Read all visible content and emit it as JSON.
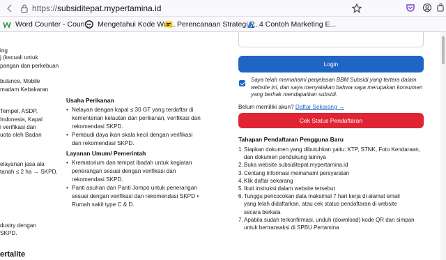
{
  "browser": {
    "url_prefix": "https://",
    "url_domain": "subsiditepat.mypertamina.id",
    "icons": [
      "lock-icon",
      "star-icon",
      "pocket-icon",
      "account-icon",
      "extensions-icon"
    ]
  },
  "bookmarks": [
    {
      "label": "Word Counter - Count...",
      "icon": "wordcounter-icon"
    },
    {
      "label": "Mengetahui Kode War...",
      "icon": "edge-icon"
    },
    {
      "label": "Perencanaan Strategi P...",
      "icon": "miro-icon"
    },
    {
      "label": "4 Contoh Marketing E...",
      "icon": "azure-icon"
    }
  ],
  "left_col": {
    "lines": [
      "ing",
      "j (kecuali untuk",
      "pangan dan perkebuan",
      "bulance, Mobile",
      "madam Kebakaran",
      "Tempel, ASDP,",
      "Indonesia, Kapal",
      "i verifikasi dan",
      "uota oleh Badan",
      "elayanan jasa ala",
      "tanah ≤ 2 ha → SKPD.",
      "dustry dengan",
      "SKPD."
    ]
  },
  "usaha_perikanan": {
    "heading": "Usaha Perikanan",
    "bullets": [
      "Nelayan dengan kapal ≤ 30 GT yang terdaftar di\nkementerian kelautan dan perikanan, verifikasi dan\nrekomendasi SKPD.",
      "Pembudi daya ikan skala kecil dengan verifikasi\ndan rekomendasi SKPD."
    ]
  },
  "layanan_umum": {
    "heading": "Layanan Umum/ Pemerintah",
    "bullets": [
      "Krematorium dan tempat ibadah untuk kegiatan\npenerangan sesuai dengan verifikasi dan\nrekomendasi SKPD.",
      "Panti asuhan dan Panti Jompo untuk penerangan\nsesuai dengan verifikasi dan rekomendasi SKPD •\nRumah sakit type C & D."
    ]
  },
  "bottom_heading": "ertalite",
  "login": {
    "button_label": "Login",
    "consent_checked": true,
    "consent_text": "Saya telah memahami penjelasan BBM Subsidi yang tertera dalam website ini, dan saya menyatakan bahwa saya merupakan konsumen yang berhak mendapatkan subsidi.",
    "register_prompt": "Belum memiliki akun?",
    "register_link": "Daftar Sekarang →",
    "cek_button_label": "Cek Status Pendaftaran"
  },
  "steps": {
    "title": "Tahapan Pendaftaran Pengguna Baru",
    "items": [
      {
        "num": "1.",
        "text": "Siapkan dokumen yang dibutuhkan yaitu: KTP, STNK, Foto Kendaraan,\ndan dokumen pendukung lainnya"
      },
      {
        "num": "2.",
        "text": "Buka website subsiditepat.mypertamina.id"
      },
      {
        "num": "3.",
        "text": "Centang informasi memahami persyaratan"
      },
      {
        "num": "4.",
        "text": "Klik daftar sekarang"
      },
      {
        "num": "5.",
        "text": "Ikuti instruksi dalam website tersebut"
      },
      {
        "num": "6.",
        "text": "Tunggu pencocokan data maksimal 7 hari kerja di alamat email\nyang telah didaftarkan, atau cek status pendaftaran di website\nsecara berkala"
      },
      {
        "num": "7.",
        "text": "Apabila sudah terkonfirmasi, unduh (download) kode QR dan simpan\nuntuk bertransaksi di SPBU Pertamina"
      }
    ]
  },
  "colors": {
    "primary_blue": "#1f66c4",
    "danger_red": "#e02434"
  }
}
